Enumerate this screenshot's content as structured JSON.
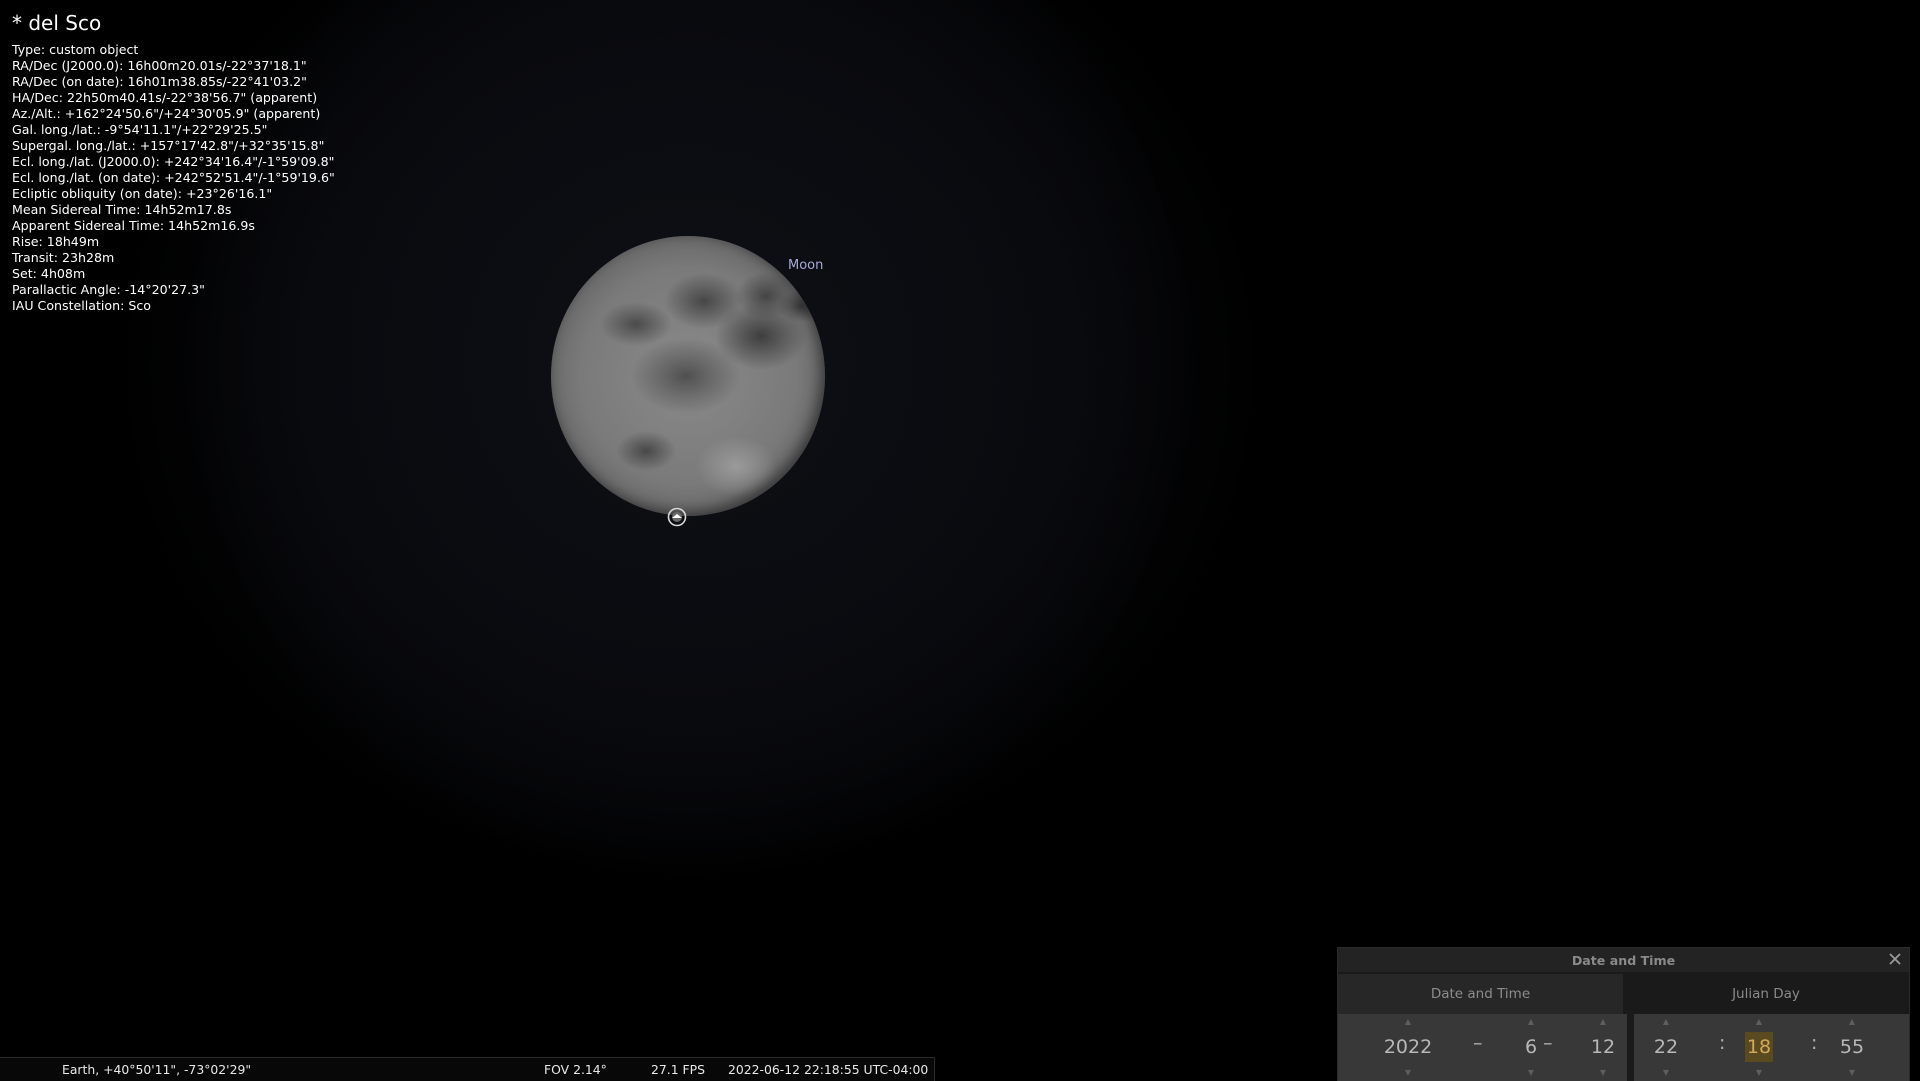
{
  "object": {
    "name": "* del Sco",
    "lines": [
      "Type: custom object",
      "RA/Dec (J2000.0): 16h00m20.01s/-22°37'18.1\"",
      "RA/Dec (on date): 16h01m38.85s/-22°41'03.2\"",
      "HA/Dec: 22h50m40.41s/-22°38'56.7\" (apparent)",
      "Az./Alt.: +162°24'50.6\"/+24°30'05.9\" (apparent)",
      "Gal. long./lat.: -9°54'11.1\"/+22°29'25.5\"",
      "Supergal. long./lat.: +157°17'42.8\"/+32°35'15.8\"",
      "Ecl. long./lat. (J2000.0): +242°34'16.4\"/-1°59'09.8\"",
      "Ecl. long./lat. (on date): +242°52'51.4\"/-1°59'19.6\"",
      "Ecliptic obliquity (on date): +23°26'16.1\"",
      "Mean Sidereal Time: 14h52m17.8s",
      "Apparent Sidereal Time: 14h52m16.9s",
      "Rise: 18h49m",
      "Transit: 23h28m",
      "Set: 4h08m",
      "Parallactic Angle: -14°20'27.3\"",
      "IAU Constellation: Sco"
    ]
  },
  "sky": {
    "moon_label": "Moon",
    "marker_icon": "selection-marker-icon"
  },
  "statusbar": {
    "location": "Earth, +40°50'11\", -73°02'29\"",
    "fov": "FOV 2.14°",
    "fps": "27.1 FPS",
    "datetime": "2022-06-12 22:18:55 UTC-04:00"
  },
  "dialog": {
    "title": "Date and Time",
    "close_icon": "close-icon",
    "tabs": [
      "Date and Time",
      "Julian Day"
    ],
    "date": {
      "year": "2022",
      "month": "6",
      "day": "12"
    },
    "time": {
      "hour": "22",
      "minute": "18",
      "second": "55"
    },
    "date_sep": "–",
    "time_sep": ":",
    "focused_field": "minute"
  }
}
